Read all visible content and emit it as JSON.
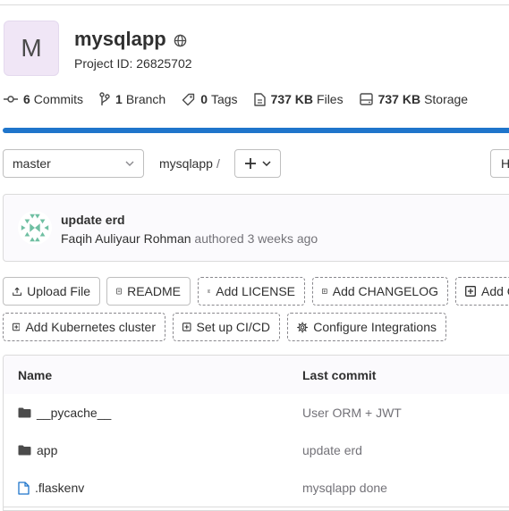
{
  "project": {
    "avatar_letter": "M",
    "name": "mysqlapp",
    "id_label": "Project ID: 26825702"
  },
  "stats": {
    "commits_count": "6",
    "commits_label": "Commits",
    "branches_count": "1",
    "branches_label": "Branch",
    "tags_count": "0",
    "tags_label": "Tags",
    "files_size": "737 KB",
    "files_label": "Files",
    "storage_size": "737 KB",
    "storage_label": "Storage"
  },
  "toolbar": {
    "branch": "master",
    "breadcrumb": "mysqlapp",
    "separator": "/",
    "right_button": "H"
  },
  "last_commit": {
    "message": "update erd",
    "author": "Faqih Auliyaur Rohman",
    "meta": " authored 3 weeks ago"
  },
  "actions": {
    "row1": [
      "Upload File",
      "README",
      "Add LICENSE",
      "Add CHANGELOG",
      "Add C"
    ],
    "row2": [
      "Add Kubernetes cluster",
      "Set up CI/CD",
      "Configure Integrations"
    ]
  },
  "table": {
    "col_name": "Name",
    "col_commit": "Last commit",
    "rows": [
      {
        "name": "__pycache__",
        "commit": "User ORM + JWT",
        "icon": "folder-icon"
      },
      {
        "name": "app",
        "commit": "update erd",
        "icon": "folder-icon"
      },
      {
        "name": ".flaskenv",
        "commit": "mysqlapp done",
        "icon": "file-icon"
      }
    ]
  },
  "colors": {
    "accent": "#1f75cb",
    "avatar_bg": "#f0e6f6",
    "identicon": "#6fbfa2"
  }
}
